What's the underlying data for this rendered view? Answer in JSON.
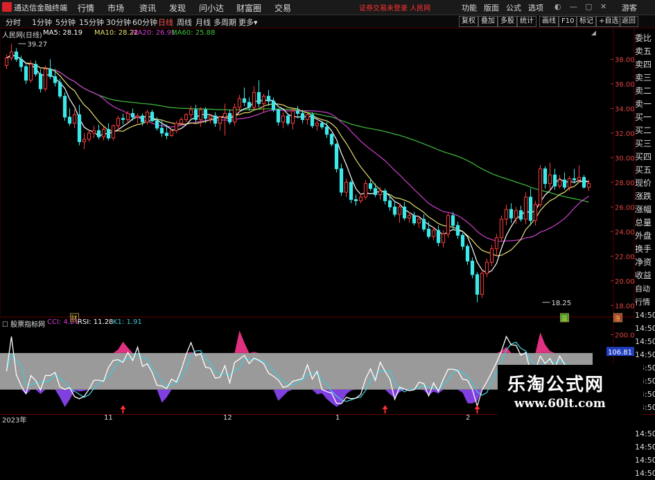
{
  "app": {
    "title": "通达信金融终端",
    "menu": [
      "行情",
      "市场",
      "资讯",
      "发现",
      "问小达",
      "财富圈",
      "交易"
    ],
    "notice": "证券交易未登录",
    "notice_name": "人民网",
    "right_menu": [
      "功能",
      "版面",
      "公式",
      "选项"
    ],
    "guest": "游客"
  },
  "toolbar": {
    "timeframes": [
      "分时",
      "1分钟",
      "5分钟",
      "15分钟",
      "30分钟",
      "60分钟",
      "日线",
      "周线",
      "月线",
      "多周期",
      "更多"
    ],
    "active": "日线",
    "buttons": [
      "复权",
      "叠加",
      "多股",
      "统计",
      "画线",
      "F10",
      "标记",
      "+自选",
      "返回"
    ]
  },
  "stock": {
    "name": "人民网(日线)"
  },
  "ma_legend": [
    {
      "label": "MA5: 28.19",
      "color": "#ffffff"
    },
    {
      "label": "MA10: 28.22",
      "color": "#e8e070"
    },
    {
      "label": "MA20: 26.91",
      "color": "#d040d0"
    },
    {
      "label": "MA60: 25.88",
      "color": "#40c040"
    }
  ],
  "osc_title": "股票指标网",
  "osc_legend": [
    {
      "label": "CCI: 4.21",
      "color": "#d040d0"
    },
    {
      "label": "RSI: 11.28",
      "color": "#ffffff"
    },
    {
      "label": "K1: 1.91",
      "color": "#40c8d8"
    }
  ],
  "right_panel": [
    "委比",
    "卖五",
    "卖四",
    "卖三",
    "卖二",
    "卖一",
    "买一",
    "买二",
    "买三",
    "买四",
    "买五",
    "现价",
    "涨跌",
    "涨幅",
    "总量",
    "外盘",
    "换手",
    "净资",
    "收益",
    "自动",
    "行情",
    "14:50",
    "14:50",
    "14:50",
    "14:50",
    "14:50",
    "14:50",
    "14:50",
    "14:50",
    "14:50",
    "14:50",
    "14:50",
    "14:50",
    "14:50"
  ],
  "dates": [
    "2023年",
    "11",
    "12",
    "1",
    "2"
  ],
  "watermark": {
    "line1": "乐淘公式网",
    "line2": "www.60lt.com"
  },
  "chart_data": [
    {
      "type": "candlestick",
      "ylim": [
        17,
        40
      ],
      "yticks": [
        "38.00",
        "36.00",
        "34.00",
        "32.00",
        "30.00",
        "28.00",
        "26.00",
        "24.00",
        "22.00",
        "20.00",
        "18.00"
      ],
      "ytick_values": [
        38,
        36,
        34,
        32,
        30,
        28,
        26,
        24,
        22,
        20,
        18
      ],
      "annotations": [
        {
          "text": "39.27",
          "x": 2,
          "y": 39.27
        },
        {
          "text": "18.25",
          "x": 110,
          "y": 18.25
        }
      ],
      "markers": [
        {
          "text": "财",
          "x": 14
        },
        {
          "text": "溢",
          "x": 115
        },
        {
          "text": "涨",
          "x": 126
        }
      ],
      "candles": [
        [
          37.5,
          38.4,
          37.2,
          38.1
        ],
        [
          38.1,
          39.27,
          37.9,
          38.6
        ],
        [
          38.6,
          38.9,
          37.8,
          38.0
        ],
        [
          38.0,
          38.3,
          37.0,
          37.4
        ],
        [
          37.4,
          37.6,
          36.0,
          36.3
        ],
        [
          36.3,
          37.9,
          36.1,
          37.6
        ],
        [
          37.6,
          37.9,
          36.6,
          36.8
        ],
        [
          36.8,
          37.2,
          35.3,
          35.6
        ],
        [
          35.6,
          37.5,
          35.4,
          37.2
        ],
        [
          37.2,
          38.0,
          36.4,
          36.6
        ],
        [
          36.6,
          37.2,
          35.8,
          36.1
        ],
        [
          36.1,
          36.4,
          34.8,
          35.0
        ],
        [
          35.0,
          35.3,
          33.0,
          33.3
        ],
        [
          33.3,
          34.0,
          32.6,
          32.8
        ],
        [
          32.8,
          33.9,
          32.4,
          33.5
        ],
        [
          33.5,
          34.3,
          31.0,
          31.3
        ],
        [
          31.3,
          32.0,
          30.7,
          31.5
        ],
        [
          31.5,
          32.3,
          31.3,
          32.0
        ],
        [
          32.0,
          32.6,
          31.6,
          32.2
        ],
        [
          32.2,
          32.7,
          31.5,
          31.7
        ],
        [
          31.7,
          32.5,
          31.4,
          32.3
        ],
        [
          32.3,
          32.8,
          31.4,
          31.6
        ],
        [
          31.6,
          32.7,
          31.4,
          32.6
        ],
        [
          32.6,
          33.4,
          32.2,
          33.2
        ],
        [
          33.2,
          33.6,
          32.7,
          33.1
        ],
        [
          33.1,
          33.8,
          32.8,
          33.6
        ],
        [
          33.6,
          34.0,
          33.0,
          33.3
        ],
        [
          33.3,
          33.6,
          32.8,
          33.4
        ],
        [
          33.4,
          33.6,
          32.6,
          32.9
        ],
        [
          32.9,
          33.9,
          32.7,
          33.7
        ],
        [
          33.7,
          33.9,
          32.9,
          33.0
        ],
        [
          33.0,
          33.3,
          32.2,
          32.4
        ],
        [
          32.4,
          33.0,
          31.7,
          32.0
        ],
        [
          32.0,
          32.7,
          31.5,
          31.8
        ],
        [
          31.8,
          32.3,
          31.7,
          32.2
        ],
        [
          32.2,
          33.0,
          32.0,
          32.8
        ],
        [
          32.8,
          33.3,
          32.7,
          33.1
        ],
        [
          33.1,
          33.6,
          32.9,
          33.5
        ],
        [
          33.5,
          34.2,
          33.2,
          33.9
        ],
        [
          33.9,
          34.3,
          32.9,
          33.1
        ],
        [
          33.1,
          34.1,
          32.5,
          33.9
        ],
        [
          33.9,
          34.1,
          32.8,
          33.2
        ],
        [
          33.2,
          33.5,
          32.8,
          33.4
        ],
        [
          33.4,
          33.7,
          32.5,
          32.8
        ],
        [
          32.8,
          33.4,
          32.2,
          33.3
        ],
        [
          33.3,
          34.4,
          31.8,
          33.6
        ],
        [
          33.6,
          33.9,
          32.7,
          32.9
        ],
        [
          32.9,
          34.4,
          32.6,
          34.1
        ],
        [
          34.1,
          35.1,
          33.7,
          34.8
        ],
        [
          34.8,
          35.7,
          34.2,
          34.5
        ],
        [
          34.5,
          34.9,
          33.8,
          34.1
        ],
        [
          34.1,
          35.8,
          33.9,
          35.3
        ],
        [
          35.3,
          36.3,
          34.1,
          34.4
        ],
        [
          34.4,
          35.2,
          33.7,
          35.0
        ],
        [
          35.0,
          35.5,
          34.2,
          34.6
        ],
        [
          34.6,
          34.9,
          33.7,
          33.9
        ],
        [
          33.9,
          34.0,
          32.6,
          32.9
        ],
        [
          32.9,
          33.7,
          32.4,
          33.4
        ],
        [
          33.4,
          33.6,
          32.6,
          32.8
        ],
        [
          32.8,
          34.0,
          32.3,
          33.8
        ],
        [
          33.8,
          34.2,
          33.2,
          33.6
        ],
        [
          33.6,
          33.9,
          32.8,
          33.1
        ],
        [
          33.1,
          33.7,
          32.7,
          33.5
        ],
        [
          33.5,
          33.7,
          32.4,
          32.6
        ],
        [
          32.6,
          33.0,
          32.2,
          32.8
        ],
        [
          32.8,
          33.0,
          32.3,
          32.5
        ],
        [
          32.5,
          32.9,
          31.6,
          31.9
        ],
        [
          31.9,
          32.0,
          30.9,
          31.1
        ],
        [
          31.1,
          31.2,
          28.8,
          29.1
        ],
        [
          29.1,
          29.5,
          26.9,
          27.2
        ],
        [
          27.2,
          28.3,
          26.8,
          28.0
        ],
        [
          28.0,
          28.2,
          26.3,
          26.6
        ],
        [
          26.6,
          27.0,
          26.1,
          26.5
        ],
        [
          26.5,
          27.1,
          26.3,
          26.8
        ],
        [
          26.8,
          28.2,
          26.6,
          27.9
        ],
        [
          27.9,
          28.3,
          27.3,
          27.5
        ],
        [
          27.5,
          27.9,
          26.8,
          27.0
        ],
        [
          27.0,
          27.6,
          26.6,
          27.3
        ],
        [
          27.3,
          27.5,
          26.2,
          26.5
        ],
        [
          26.5,
          26.9,
          25.7,
          26.0
        ],
        [
          26.0,
          26.5,
          25.2,
          25.4
        ],
        [
          25.4,
          26.3,
          24.7,
          26.0
        ],
        [
          26.0,
          26.4,
          24.9,
          25.1
        ],
        [
          25.1,
          25.6,
          24.7,
          25.3
        ],
        [
          25.3,
          25.6,
          24.5,
          24.7
        ],
        [
          24.7,
          25.3,
          24.3,
          25.0
        ],
        [
          25.0,
          25.4,
          24.0,
          24.2
        ],
        [
          24.2,
          24.8,
          23.4,
          23.6
        ],
        [
          23.6,
          24.4,
          23.3,
          24.1
        ],
        [
          24.1,
          24.5,
          22.8,
          23.1
        ],
        [
          23.1,
          24.1,
          22.7,
          23.8
        ],
        [
          23.8,
          25.5,
          23.5,
          25.3
        ],
        [
          25.3,
          25.6,
          24.2,
          24.5
        ],
        [
          24.5,
          24.8,
          23.4,
          23.7
        ],
        [
          23.7,
          23.9,
          22.5,
          22.8
        ],
        [
          22.8,
          23.0,
          21.3,
          21.6
        ],
        [
          21.6,
          21.9,
          20.2,
          20.5
        ],
        [
          20.5,
          20.7,
          18.25,
          18.9
        ],
        [
          18.9,
          20.9,
          18.6,
          20.6
        ],
        [
          20.6,
          21.8,
          20.3,
          21.5
        ],
        [
          21.5,
          22.9,
          21.2,
          22.6
        ],
        [
          22.6,
          23.8,
          22.0,
          23.5
        ],
        [
          23.5,
          25.3,
          23.2,
          25.0
        ],
        [
          25.0,
          26.2,
          24.5,
          25.8
        ],
        [
          25.8,
          26.3,
          24.7,
          25.1
        ],
        [
          25.1,
          26.0,
          24.6,
          25.7
        ],
        [
          25.7,
          26.1,
          24.8,
          25.0
        ],
        [
          25.0,
          27.2,
          24.6,
          26.8
        ],
        [
          26.8,
          27.5,
          24.5,
          24.9
        ],
        [
          24.9,
          26.5,
          24.5,
          26.2
        ],
        [
          26.2,
          29.4,
          26.0,
          29.1
        ],
        [
          29.1,
          29.3,
          27.5,
          27.9
        ],
        [
          27.9,
          29.6,
          27.3,
          28.6
        ],
        [
          28.6,
          29.1,
          27.4,
          27.7
        ],
        [
          27.7,
          28.6,
          27.5,
          28.2
        ],
        [
          28.2,
          28.8,
          27.4,
          27.6
        ],
        [
          27.6,
          28.5,
          27.3,
          28.3
        ],
        [
          28.3,
          29.1,
          27.9,
          28.2
        ],
        [
          28.2,
          29.4,
          28.0,
          28.4
        ],
        [
          28.4,
          28.6,
          27.5,
          27.6
        ],
        [
          27.6,
          28.2,
          27.3,
          27.9
        ]
      ]
    },
    {
      "type": "line",
      "name": "oscillator",
      "yticks": [
        "200.00",
        "100.00",
        "0.00"
      ],
      "ytick_values": [
        200,
        100,
        0
      ],
      "ylim": [
        -230,
        240
      ],
      "band": [
        -100,
        100
      ],
      "current_value": "106.81",
      "arrows_x": [
        24,
        78,
        97,
        110,
        122,
        128,
        138
      ]
    }
  ]
}
